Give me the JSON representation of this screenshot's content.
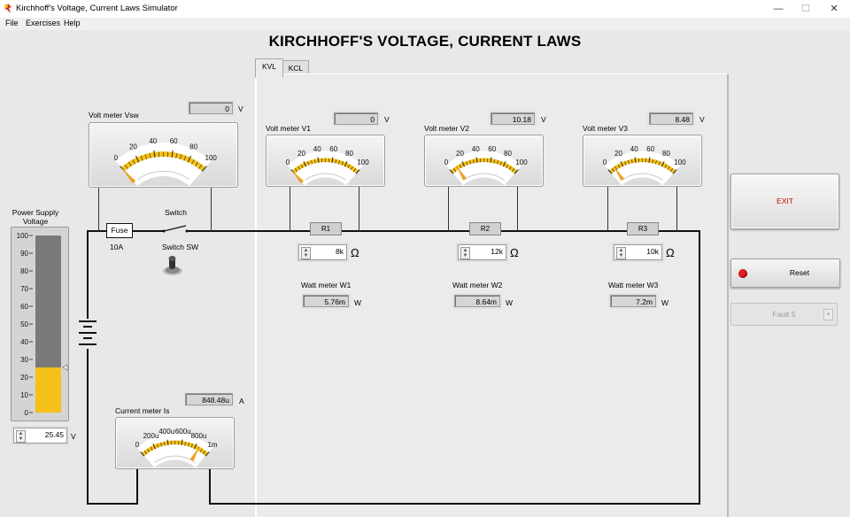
{
  "window": {
    "title": "Kirchhoff's Voltage, Current Laws Simulator",
    "controls": {
      "minimize": "—",
      "maximize": "☐",
      "close": "✕"
    }
  },
  "menu": {
    "file": "File",
    "exercises": "Exercises",
    "help": "Help"
  },
  "main_title": "KIRCHHOFF'S VOLTAGE, CURRENT LAWS",
  "tabs": {
    "kvl": "KVL",
    "kcl": "KCL"
  },
  "power_supply": {
    "label": "Power Supply Voltage",
    "scale": [
      "100",
      "90",
      "80",
      "70",
      "60",
      "50",
      "40",
      "30",
      "20",
      "10",
      "0"
    ],
    "level_fraction": 0.2545,
    "value": "25.45",
    "unit": "V"
  },
  "voltmeter_vsw": {
    "label": "Volt meter Vsw",
    "value": "0",
    "unit": "V",
    "scale": [
      "0",
      "20",
      "40",
      "60",
      "80",
      "100"
    ],
    "needle_fraction": 0.0
  },
  "voltmeter_v1": {
    "label": "Volt meter V1",
    "value": "0",
    "unit": "V",
    "scale": [
      "0",
      "20",
      "40",
      "60",
      "80",
      "100"
    ],
    "needle_fraction": 0.0
  },
  "voltmeter_v2": {
    "label": "Volt meter V2",
    "value": "10.18",
    "unit": "V",
    "scale": [
      "0",
      "20",
      "40",
      "60",
      "80",
      "100"
    ],
    "needle_fraction": 0.1018
  },
  "voltmeter_v3": {
    "label": "Volt meter V3",
    "value": "8.48",
    "unit": "V",
    "scale": [
      "0",
      "20",
      "40",
      "60",
      "80",
      "100"
    ],
    "needle_fraction": 0.0848
  },
  "current_meter": {
    "label": "Current meter Is",
    "value": "848.48u",
    "unit": "A",
    "scale": [
      "0",
      "200u",
      "400u",
      "600u",
      "800u",
      "1m"
    ],
    "needle_fraction": 0.8485
  },
  "circuit": {
    "fuse_label": "Fuse",
    "fuse_rating": "10A",
    "switch_label": "Switch",
    "switch_sw_label": "Switch SW"
  },
  "resistors": [
    {
      "label": "R1",
      "value": "8k",
      "unit": "Ω"
    },
    {
      "label": "R2",
      "value": "12k",
      "unit": "Ω"
    },
    {
      "label": "R3",
      "value": "10k",
      "unit": "Ω"
    }
  ],
  "wattmeters": [
    {
      "label": "Watt meter W1",
      "value": "5.76m",
      "unit": "W"
    },
    {
      "label": "Watt meter W2",
      "value": "8.64m",
      "unit": "W"
    },
    {
      "label": "Watt meter W3",
      "value": "7.2m",
      "unit": "W"
    }
  ],
  "buttons": {
    "exit": "EXIT",
    "reset": "Reset",
    "fault": "Fault 5"
  },
  "colors": {
    "gauge_fill": "#f5c017",
    "needle": "#f0a020",
    "exit_text": "#d00000",
    "reset_led": "#e02020"
  }
}
